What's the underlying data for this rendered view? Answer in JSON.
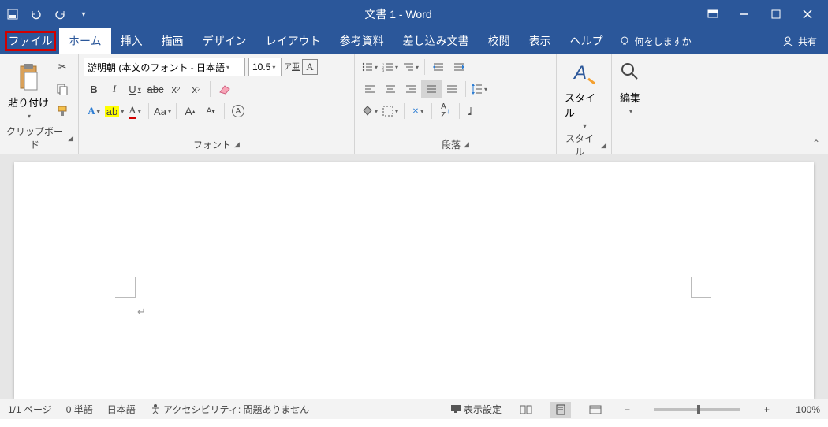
{
  "title": "文書 1  -  Word",
  "qat": {
    "save": "save-icon",
    "undo": "undo-icon",
    "redo": "redo-icon"
  },
  "tabs": {
    "file": "ファイル",
    "items": [
      "ホーム",
      "挿入",
      "描画",
      "デザイン",
      "レイアウト",
      "参考資料",
      "差し込み文書",
      "校閲",
      "表示",
      "ヘルプ"
    ],
    "active_index": 0,
    "tellme": "何をしますか",
    "share": "共有"
  },
  "ribbon": {
    "clipboard": {
      "paste": "貼り付け",
      "label": "クリップボード"
    },
    "font": {
      "name": "游明朝 (本文のフォント - 日本語",
      "size": "10.5",
      "label": "フォント"
    },
    "paragraph": {
      "label": "段落"
    },
    "styles": {
      "button": "スタイル",
      "label": "スタイル"
    },
    "editing": {
      "button": "編集"
    }
  },
  "status": {
    "page": "1/1 ページ",
    "words": "0 単語",
    "lang": "日本語",
    "a11y": "アクセシビリティ: 問題ありません",
    "display": "表示設定",
    "zoom": "100%"
  }
}
